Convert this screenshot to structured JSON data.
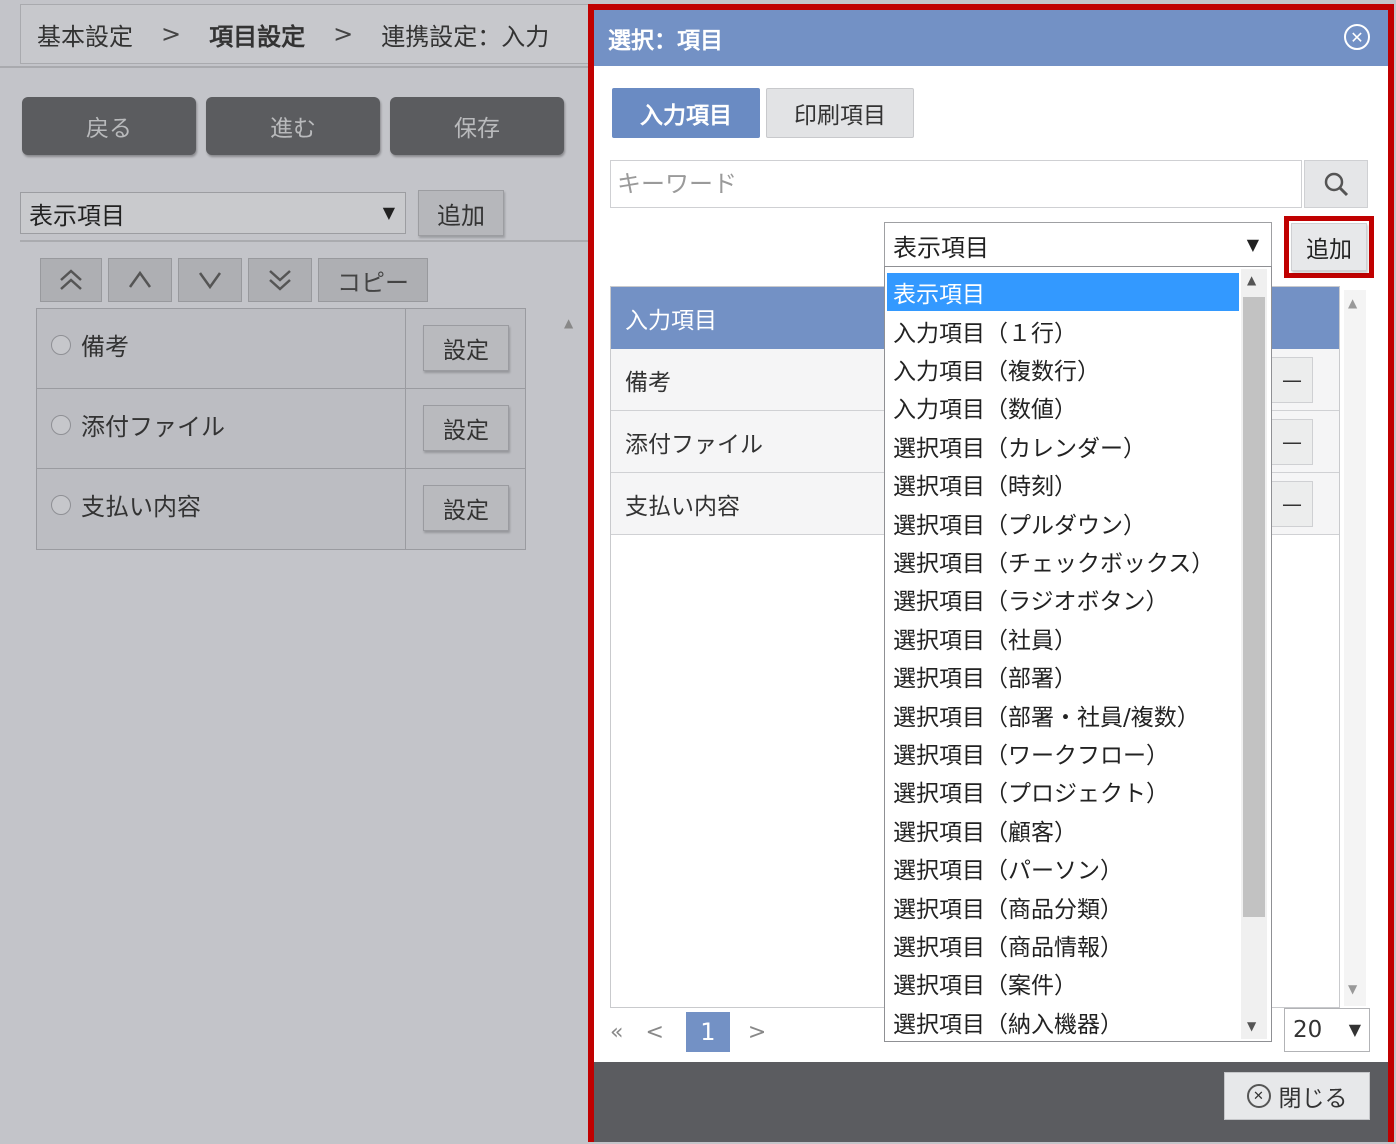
{
  "background": {
    "breadcrumb": [
      "基本設定",
      "項目設定",
      "連携設定：入力"
    ],
    "breadcrumb_sep": ">",
    "buttons": [
      "戻る",
      "進む",
      "保存"
    ],
    "item_type_select": "表示項目",
    "add_label": "追加",
    "copy_label": "コピー",
    "rows": [
      "備考",
      "添付ファイル",
      "支払い内容"
    ],
    "row_action": "設定"
  },
  "dialog": {
    "title": "選択：項目",
    "tabs": [
      "入力項目",
      "印刷項目"
    ],
    "search_placeholder": "キーワード",
    "type_select_value": "表示項目",
    "add_label": "追加",
    "list_header": "入力項目",
    "rows": [
      "備考",
      "添付ファイル",
      "支払い内容"
    ],
    "row_mini_label": "—",
    "pager": {
      "first": "«",
      "prev": "<",
      "current": "1",
      "next": ">"
    },
    "per_page": "20",
    "close_label": "閉じる",
    "dropdown_options": [
      "表示項目",
      "入力項目（１行）",
      "入力項目（複数行）",
      "入力項目（数値）",
      "選択項目（カレンダー）",
      "選択項目（時刻）",
      "選択項目（プルダウン）",
      "選択項目（チェックボックス）",
      "選択項目（ラジオボタン）",
      "選択項目（社員）",
      "選択項目（部署）",
      "選択項目（部署・社員/複数）",
      "選択項目（ワークフロー）",
      "選択項目（プロジェクト）",
      "選択項目（顧客）",
      "選択項目（パーソン）",
      "選択項目（商品分類）",
      "選択項目（商品情報）",
      "選択項目（案件）",
      "選択項目（納入機器）"
    ],
    "dropdown_selected_index": 0
  },
  "colors": {
    "accent_blue": "#7391c5",
    "highlight_red": "#c00000",
    "selected_option": "#3399ff"
  }
}
